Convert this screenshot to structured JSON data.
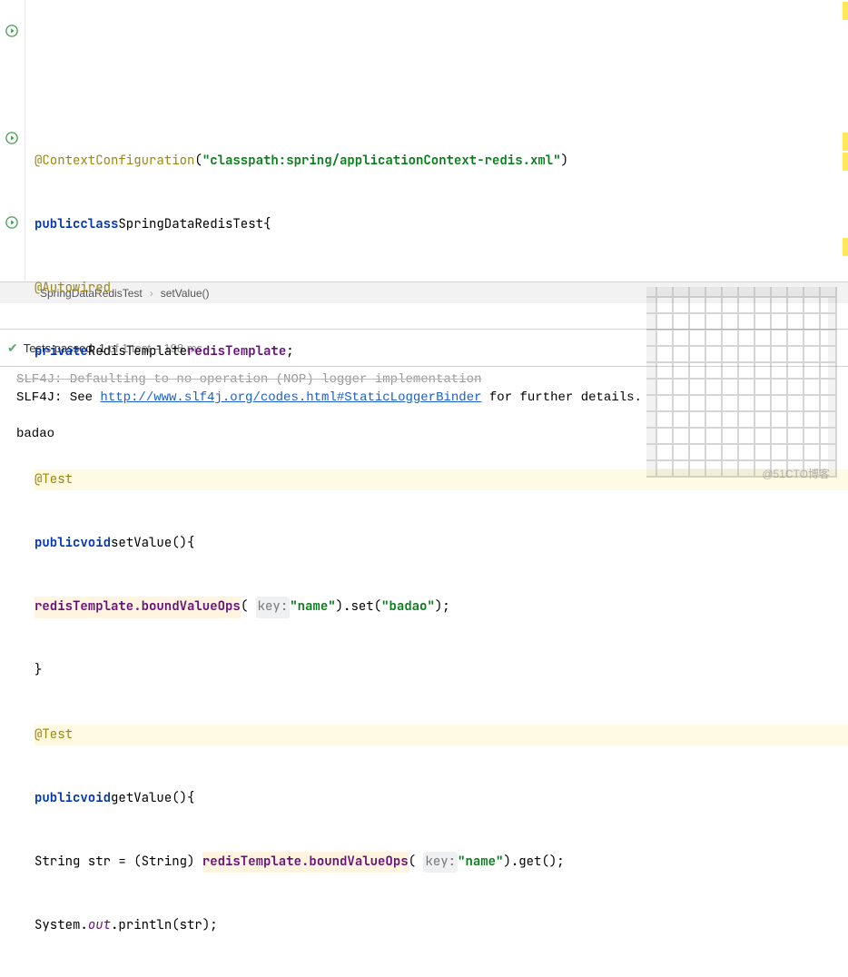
{
  "code": {
    "l1_annotation": "@ContextConfiguration",
    "l1_str": "\"classpath:spring/applicationContext-redis.xml\"",
    "l2_kw1": "public",
    "l2_kw2": "class",
    "l2_classname": "SpringDataRedisTest",
    "l3_annotation": "@Autowired",
    "l4_kw": "private",
    "l4_type": "RedisTemplate",
    "l4_field": "redisTemplate",
    "l6_annotation": "@Test",
    "l7_kw1": "public",
    "l7_kw2": "void",
    "l7_method": "setValue",
    "l8_field": "redisTemplate",
    "l8_call": ".boundValueOps",
    "l8_hint": "key:",
    "l8_str1": "\"name\"",
    "l8_set": ".set(",
    "l8_str2": "\"badao\"",
    "l10_annotation": "@Test",
    "l11_kw1": "public",
    "l11_kw2": "void",
    "l11_method": "getValue",
    "l12_decl": "String str = (String) ",
    "l12_field": "redisTemplate",
    "l12_call": ".boundValueOps",
    "l12_hint": "key:",
    "l12_str": "\"name\"",
    "l12_get": ".get();",
    "l13_sys": "System.",
    "l13_out": "out",
    "l13_println": ".println(str);"
  },
  "breadcrumb": {
    "class": "SpringDataRedisTest",
    "method": "setValue()"
  },
  "test": {
    "label_prefix": "Tests passed:",
    "count": "1",
    "of": "of 1 test",
    "duration": "– 198 ms"
  },
  "console": {
    "line1": "SLF4J: Defaulting to no-operation (NOP) logger implementation",
    "line2_prefix": "SLF4J: See ",
    "line2_link": "http://www.slf4j.org/codes.html#StaticLoggerBinder",
    "line2_suffix": " for further details.",
    "output": "badao"
  },
  "watermark": "@51CTO博客"
}
